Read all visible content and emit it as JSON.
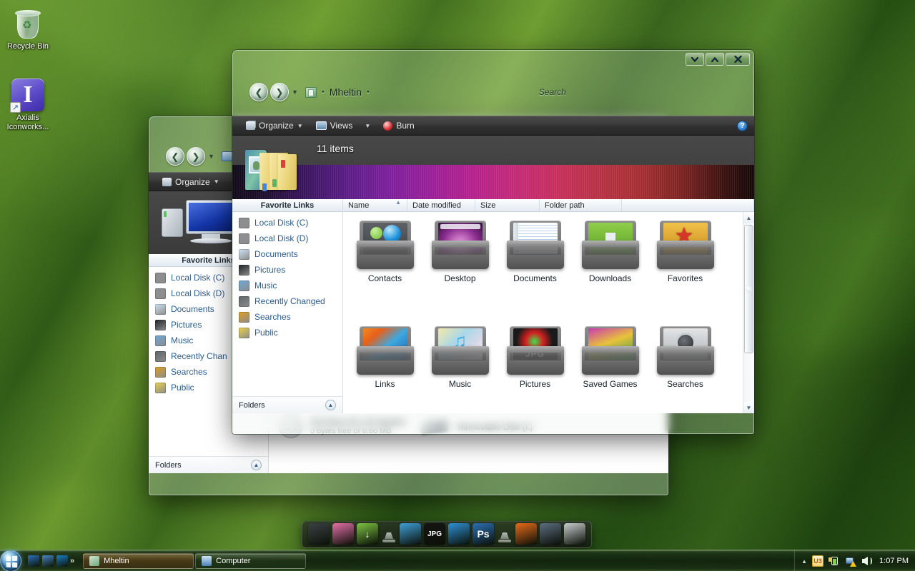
{
  "desktop": {
    "icons": [
      {
        "label": "Recycle Bin",
        "icon": "recycle-bin-icon"
      },
      {
        "label": "Axialis Iconworks...",
        "icon": "axialis-iconworks-shortcut-icon"
      }
    ]
  },
  "explorer_window": {
    "title": "Mheltin",
    "breadcrumb": {
      "root_icon": "user-folder-icon",
      "sep1": "•",
      "path": "Mheltin",
      "sep2": "•"
    },
    "search_placeholder": "Search",
    "window_controls": {
      "minimize": "▼",
      "maximize": "▲",
      "close": "X"
    },
    "toolbar": {
      "organize": "Organize",
      "views": "Views",
      "burn": "Burn",
      "caret": "▼",
      "help": "?"
    },
    "banner": {
      "count": "11 items"
    },
    "columns": [
      "Name",
      "Date modified",
      "Size",
      "Folder path"
    ],
    "sort_column": "Name",
    "sort_mark": "▲",
    "favorite_links": {
      "title": "Favorite Links",
      "items": [
        {
          "label": "Local Disk (C)",
          "color": "#8d8f92"
        },
        {
          "label": "Local Disk (D)",
          "color": "#8d8f92"
        },
        {
          "label": "Documents",
          "color": "#cfe3f5"
        },
        {
          "label": "Pictures",
          "color": "#1d2326"
        },
        {
          "label": "Music",
          "color": "#6ea8d8"
        },
        {
          "label": "Recently Changed",
          "color": "#5d6569"
        },
        {
          "label": "Searches",
          "color": "#e0a020"
        },
        {
          "label": "Public",
          "color": "#e8d24a"
        }
      ]
    },
    "folders_bar": {
      "label": "Folders",
      "chevron": "▲"
    },
    "items": [
      {
        "label": "Contacts",
        "icon": "contacts-folder-icon"
      },
      {
        "label": "Desktop",
        "icon": "desktop-folder-icon"
      },
      {
        "label": "Documents",
        "icon": "documents-folder-icon"
      },
      {
        "label": "Downloads",
        "icon": "downloads-folder-icon"
      },
      {
        "label": "Favorites",
        "icon": "favorites-folder-icon"
      },
      {
        "label": "Links",
        "icon": "links-folder-icon"
      },
      {
        "label": "Music",
        "icon": "music-folder-icon"
      },
      {
        "label": "Pictures",
        "icon": "pictures-folder-icon"
      },
      {
        "label": "Saved Games",
        "icon": "saved-games-folder-icon"
      },
      {
        "label": "Searches",
        "icon": "searches-folder-icon"
      }
    ]
  },
  "computer_window": {
    "title": "Computer",
    "toolbar": {
      "organize": "Organize",
      "caret": "▼"
    },
    "favorite_links": {
      "title": "Favorite Links",
      "items": [
        {
          "label": "Local Disk (C)",
          "color": "#8d8f92"
        },
        {
          "label": "Local Disk (D)",
          "color": "#8d8f92"
        },
        {
          "label": "Documents",
          "color": "#cfe3f5"
        },
        {
          "label": "Pictures",
          "color": "#1d2326"
        },
        {
          "label": "Music",
          "color": "#6ea8d8"
        },
        {
          "label": "Recently Chan",
          "color": "#5d6569"
        },
        {
          "label": "Searches",
          "color": "#e0a020"
        },
        {
          "label": "Public",
          "color": "#e8d24a"
        }
      ]
    },
    "folders_bar": {
      "label": "Folders",
      "chevron": "▲"
    },
    "drives": [
      {
        "name": "CD Drive (H:) U3 System",
        "detail": "0 bytes free of 6.66 MB",
        "icon": "cd-drive-icon"
      },
      {
        "name": "Removable Disk (I:)",
        "detail": "",
        "icon": "removable-disk-icon"
      }
    ]
  },
  "dock": {
    "items": [
      {
        "name": "finder-icon",
        "glyph": "",
        "color": "#3a3f44"
      },
      {
        "name": "trash-pink-icon",
        "glyph": "",
        "color": "#e46ea8"
      },
      {
        "name": "downloads-icon",
        "glyph": "↓",
        "color": "#7dc242"
      },
      {
        "name": "separator-1",
        "glyph": "",
        "color": ""
      },
      {
        "name": "developer-tools-icon",
        "glyph": "",
        "color": "#3f9fd8"
      },
      {
        "name": "jpg-viewer-icon",
        "glyph": "JPG",
        "color": "#141414"
      },
      {
        "name": "adium-icon",
        "glyph": "",
        "color": "#2e8fd4"
      },
      {
        "name": "photoshop-icon",
        "glyph": "Ps",
        "color": "#2a6fb5"
      },
      {
        "name": "separator-2",
        "glyph": "",
        "color": ""
      },
      {
        "name": "firefox-icon",
        "glyph": "",
        "color": "#e86a1a"
      },
      {
        "name": "utilities-icon",
        "glyph": "",
        "color": "#5c6d80"
      },
      {
        "name": "trash-can-icon",
        "glyph": "",
        "color": "#c9ccce"
      }
    ]
  },
  "taskbar": {
    "start_label": "Start",
    "quick_launch": [
      {
        "name": "show-desktop-icon",
        "color": "#2c6fba"
      },
      {
        "name": "switch-windows-icon",
        "color": "#4a86c4"
      },
      {
        "name": "internet-explorer-icon",
        "color": "#1b7dc4"
      }
    ],
    "quick_launch_overflow": "»",
    "buttons": [
      {
        "label": "Mheltin",
        "active": true,
        "icon": "user-folder-icon"
      },
      {
        "label": "Computer",
        "active": false,
        "icon": "computer-icon"
      }
    ],
    "tray": {
      "chevron": "▲",
      "icons": [
        {
          "name": "u3-launchpad-icon",
          "label": "U3"
        },
        {
          "name": "power-battery-icon",
          "label": ""
        },
        {
          "name": "network-warning-icon",
          "label": ""
        },
        {
          "name": "volume-icon",
          "label": ""
        }
      ],
      "clock": "1:07 PM"
    }
  },
  "colors": {
    "wallpaper_green": "#3d6a1c",
    "taskbar_green": "#1a2f12",
    "toolbar_dark": "#3a3a3a",
    "link_blue": "#2b5c8f",
    "banner_purple": "#7d1f9c"
  }
}
